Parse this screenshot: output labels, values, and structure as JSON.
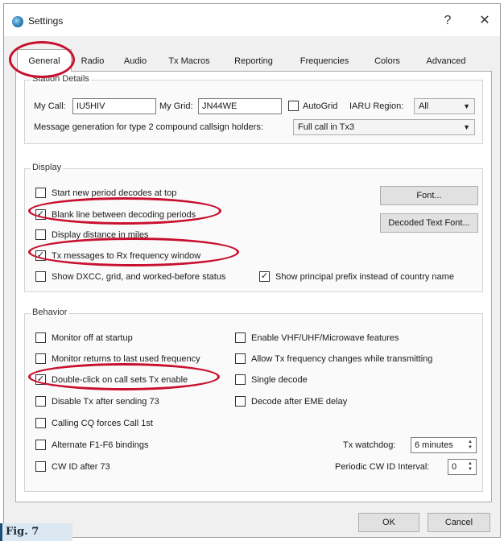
{
  "window": {
    "title": "Settings",
    "help": "?",
    "close": "✕"
  },
  "tabs": [
    "General",
    "Radio",
    "Audio",
    "Tx Macros",
    "Reporting",
    "Frequencies",
    "Colors",
    "Advanced"
  ],
  "station": {
    "group_title": "Station Details",
    "my_call_label": "My Call:",
    "my_call_value": "IU5HIV",
    "my_grid_label": "My Grid:",
    "my_grid_value": "JN44WE",
    "autogrid_label": "AutoGrid",
    "iaru_label": "IARU Region:",
    "iaru_value": "All",
    "msg_gen_label": "Message generation for type 2 compound callsign holders:",
    "msg_gen_value": "Full call in Tx3"
  },
  "display": {
    "group_title": "Display",
    "start_new": "Start new period decodes at top",
    "blank_line": "Blank line between decoding periods",
    "distance_miles": "Display distance in miles",
    "tx_messages": "Tx messages to Rx frequency window",
    "show_dxcc": "Show DXCC, grid, and worked-before status",
    "principal_prefix": "Show principal prefix instead of country name",
    "font_button": "Font...",
    "decoded_font_button": "Decoded Text Font..."
  },
  "behavior": {
    "group_title": "Behavior",
    "monitor_off": "Monitor off at startup",
    "monitor_returns": "Monitor returns to last used frequency",
    "double_click": "Double-click on call sets Tx enable",
    "disable_tx": "Disable Tx after sending 73",
    "calling_cq": "Calling CQ forces Call 1st",
    "alternate_f1": "Alternate F1-F6 bindings",
    "cw_id": "CW ID after 73",
    "enable_vhf": "Enable VHF/UHF/Microwave features",
    "allow_tx_freq": "Allow Tx frequency changes while transmitting",
    "single_decode": "Single decode",
    "decode_eme": "Decode after EME delay",
    "tx_watchdog_label": "Tx watchdog:",
    "tx_watchdog_value": "6 minutes",
    "periodic_cw_label": "Periodic CW ID Interval:",
    "periodic_cw_value": "0"
  },
  "checks": {
    "blank_line": "✓",
    "tx_messages": "✓",
    "principal_prefix": "✓",
    "double_click": "✓"
  },
  "buttons": {
    "ok": "OK",
    "cancel": "Cancel"
  },
  "caption": "Fig. 7",
  "colors": {
    "highlight_oval": "#c8102e",
    "caption_bg": "#dbe8f2"
  }
}
